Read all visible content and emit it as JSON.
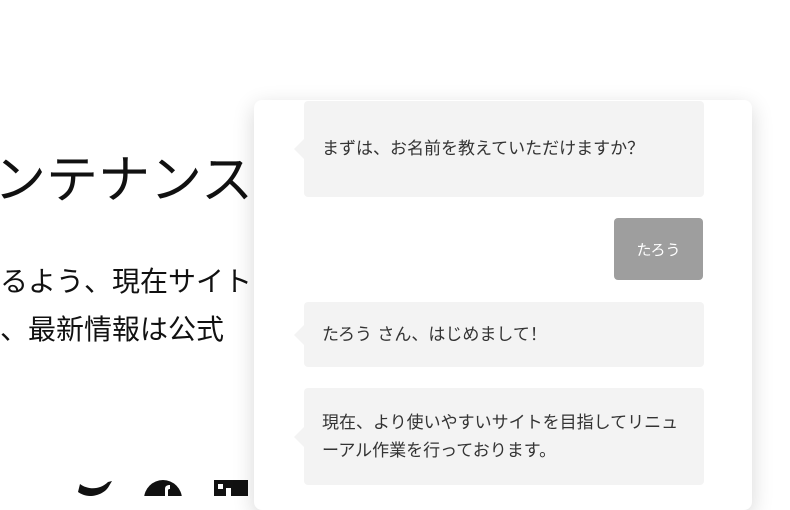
{
  "background": {
    "title": "ンテナンス",
    "line1": "るよう、現在サイト",
    "line2": "、最新情報は公式"
  },
  "social_icons": [
    "twitter-icon",
    "facebook-icon",
    "linkedin-icon"
  ],
  "chat": {
    "messages": [
      {
        "from": "bot",
        "text": "まずは、お名前を教えていただけますか？"
      },
      {
        "from": "user",
        "text": "たろう"
      },
      {
        "from": "bot",
        "text": "たろう さん、はじめまして！"
      },
      {
        "from": "bot",
        "text": "現在、より使いやすいサイトを目指してリニューアル作業を行っております。"
      }
    ]
  },
  "colors": {
    "bot_bubble": "#f3f3f3",
    "user_bubble": "#9e9e9e",
    "text": "#333333"
  }
}
